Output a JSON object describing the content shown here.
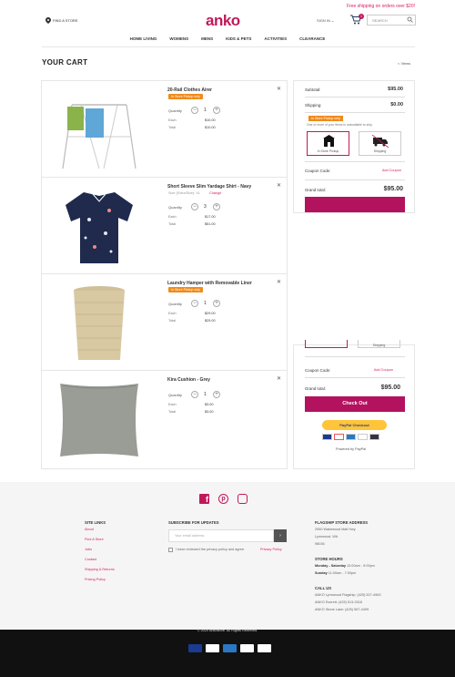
{
  "header": {
    "promo": "Free shipping on orders over $20!",
    "find_store": "FIND A STORE",
    "logo": "anko",
    "signin": "SIGN IN",
    "cart_count": "1",
    "search_placeholder": "SEARCH"
  },
  "nav": [
    "HOME LIVING",
    "WOMENS",
    "MENS",
    "KIDS & PETS",
    "ACTIVITIES",
    "CLEARANCE"
  ],
  "cart": {
    "title": "YOUR CART",
    "views_link": "< Views",
    "items": [
      {
        "name": "20-Rail Clothes Airer",
        "badge": "In Store Pickup only",
        "qty_label": "Quantity",
        "qty": "1",
        "each_label": "Each",
        "each": "$10.00",
        "total_label": "Total",
        "total": "$10.00"
      },
      {
        "name": "Short Sleeve Slim Yardage Shirt - Navy",
        "variant": "Size (Extra/Size): XL",
        "change": "Change",
        "qty_label": "Quantity",
        "qty": "3",
        "each_label": "Each",
        "each": "$17.00",
        "total_label": "Total",
        "total": "$51.00"
      },
      {
        "name": "Laundry Hamper with Removable Liner",
        "badge": "In Store Pickup only",
        "qty_label": "Quantity",
        "qty": "1",
        "each_label": "Each",
        "each": "$29.00",
        "total_label": "Total",
        "total": "$29.00"
      },
      {
        "name": "Kira Cushion - Grey",
        "qty_label": "Quantity",
        "qty": "1",
        "each_label": "Each",
        "each": "$3.00",
        "total_label": "Total",
        "total": "$3.00"
      }
    ]
  },
  "summary": {
    "subtotal_label": "Subtotal:",
    "subtotal": "$95.00",
    "shipping_label": "Shipping:",
    "shipping": "$0.00",
    "pickup_badge": "In Store Pickup only",
    "pickup_note": "One or more of your items is unavailable to ship.",
    "option_pickup": "In Store Pickup",
    "option_shipping": "Shipping",
    "coupon_label": "Coupon Code:",
    "coupon_link": "Add Coupon",
    "grand_label": "Grand total:",
    "grand": "$95.00",
    "checkout": "Check Out",
    "paypal": "PayPal Checkout",
    "powered": "Powered by PayPal"
  },
  "footer": {
    "site_links_title": "SITE LINKS",
    "site_links": [
      "About",
      "Find A Store",
      "Jobs",
      "Contact",
      "Shipping & Returns",
      "Pricing Policy"
    ],
    "subscribe_title": "SUBSCRIBE FOR UPDATES",
    "email_placeholder": "Your email address",
    "agree": "I have reviewed the privacy policy and agree.",
    "privacy": "Privacy Policy",
    "flagship_title": "FLAGSHIP STORE ADDRESS",
    "address": [
      "2950 Wakewood Mall Hwy",
      "Lynnwood, WA",
      "98036"
    ],
    "hours_title": "STORE HOURS",
    "hours_1_label": "Monday - Saturday",
    "hours_1": "10:00am - 9:00pm",
    "hours_2_label": "Sunday",
    "hours_2": "11:00am - 7:00pm",
    "call_title": "CALL US",
    "calls": [
      "ANKO Lynnwood Flagship: (425) 527-4963",
      "ANKO Everett: (425) 513-3318",
      "ANKO Stone Lake: (425) 557-4499"
    ],
    "copyright": "© 2020 Ankostore. All Rights Reserved."
  },
  "colors": {
    "brand": "#c2185b",
    "badge": "#f08a1c",
    "checkout": "#b3125f"
  }
}
